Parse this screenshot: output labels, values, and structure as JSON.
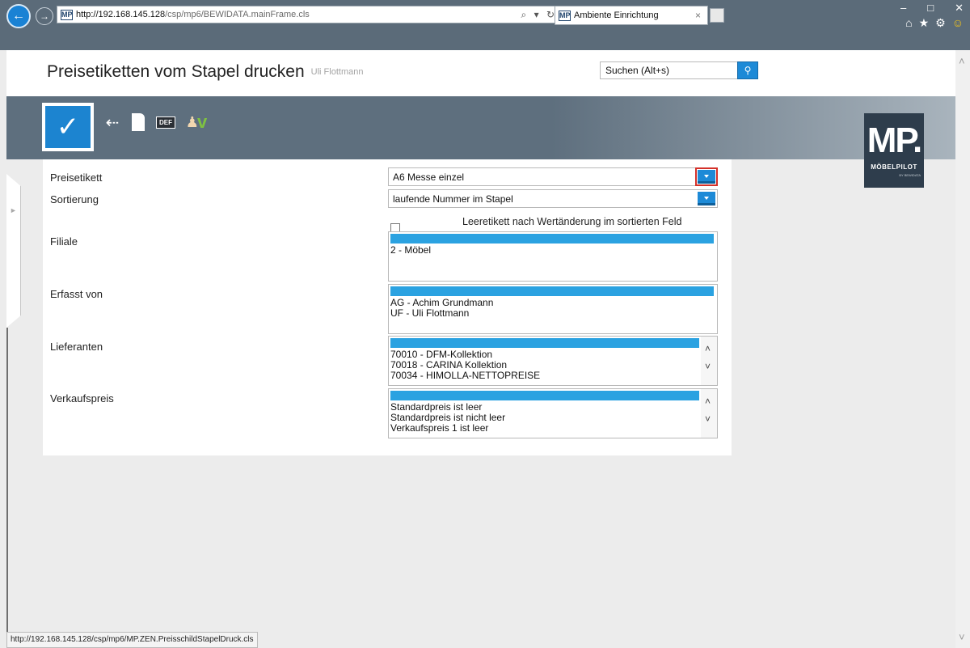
{
  "browser": {
    "address_host": "http://192.168.145.128",
    "address_path": "/csp/mp6/BEWIDATA.mainFrame.cls",
    "address_tools": "⌕ ▾ ↻",
    "favicon_text": "MP",
    "tab_title": "Ambiente Einrichtung",
    "tab_close": "×",
    "window_controls": [
      "–",
      "□",
      "✕"
    ],
    "back_glyph": "←",
    "forward_glyph": "→",
    "toolbar_icons": [
      "⌂",
      "★",
      "⚙",
      "☺"
    ]
  },
  "page": {
    "title": "Preisetiketten vom Stapel drucken",
    "user": "Uli Flottmann",
    "search_placeholder": "Suchen (Alt+s)"
  },
  "toolbar": {
    "confirm_glyph": "✓",
    "back_glyph": "⇠",
    "def_label": "DEF",
    "user_check_glyph": "v",
    "user_glyph": "♟"
  },
  "logo": {
    "big": "MP.",
    "name": "MÖBELPILOT",
    "tag": "BY BEWIDATA"
  },
  "form": {
    "preisetikett_label": "Preisetikett",
    "preisetikett_value": "A6 Messe einzel",
    "sortierung_label": "Sortierung",
    "sortierung_value": "laufende Nummer im Stapel",
    "leeretikett_label": "Leeretikett nach Wertänderung im sortierten Feld",
    "filiale_label": "Filiale",
    "filiale_options": [
      "2 - Möbel"
    ],
    "erfasst_label": "Erfasst von",
    "erfasst_options": [
      "AG - Achim Grundmann",
      "UF - Uli Flottmann"
    ],
    "lieferanten_label": "Lieferanten",
    "lieferanten_options": [
      "70010 - DFM-Kollektion",
      "70018 - CARINA Kollektion",
      "70034 - HIMOLLA-NETTOPREISE"
    ],
    "verkaufspreis_label": "Verkaufspreis",
    "verkaufspreis_options": [
      "Standardpreis ist leer",
      "Standardpreis ist nicht leer",
      "Verkaufspreis 1 ist leer"
    ],
    "scroll_up": "˄",
    "scroll_down": "˅"
  },
  "status_bar": {
    "url": "http://192.168.145.128/csp/mp6/MP.ZEN.PreisschildStapelDruck.cls"
  },
  "colors": {
    "accent_blue": "#1d8ad7",
    "highlight_red": "#d4312a",
    "toolbar_gray": "#5e6f7e"
  }
}
